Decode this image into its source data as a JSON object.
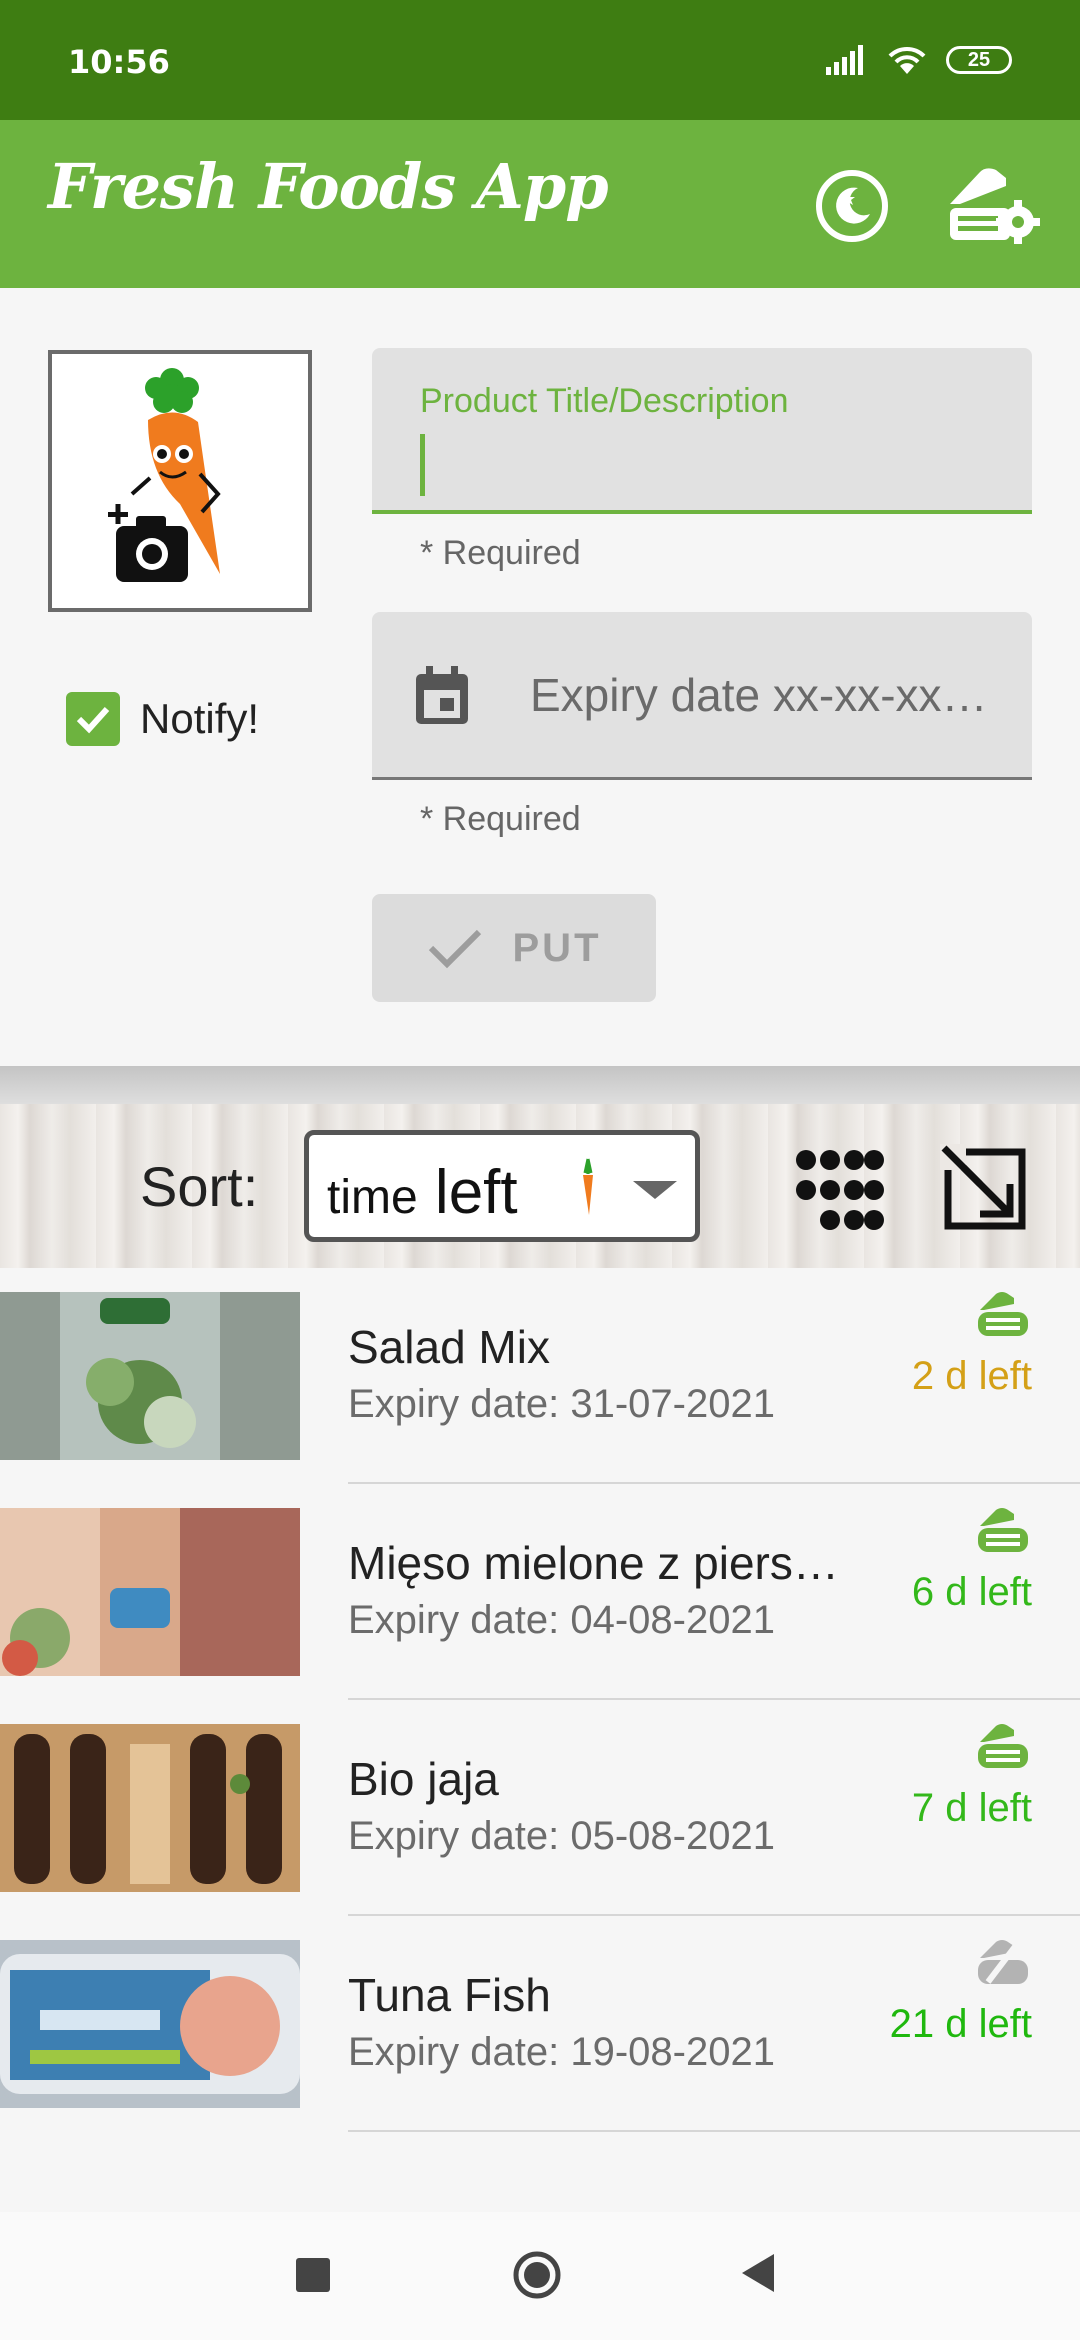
{
  "status_bar": {
    "time": "10:56",
    "battery": "25"
  },
  "app_bar": {
    "title": "Fresh Foods App"
  },
  "form": {
    "title_field": {
      "label": "Product Title/Description",
      "value": "",
      "helper": "* Required"
    },
    "date_field": {
      "placeholder": "Expiry date xx-xx-xx…",
      "helper": "* Required"
    },
    "notify": {
      "label": "Notify!",
      "checked": true
    },
    "put_button": {
      "label": "PUT"
    }
  },
  "sort": {
    "label": "Sort:",
    "selected_small": "time",
    "selected_big": "left"
  },
  "items": [
    {
      "title": "Salad Mix",
      "expiry": "Expiry date: 31-07-2021",
      "days": "2 d left",
      "days_color": "#d4a017",
      "notify": true
    },
    {
      "title": "Mięso mielone z piers…",
      "expiry": "Expiry date: 04-08-2021",
      "days": "6 d left",
      "days_color": "#33b81a",
      "notify": true
    },
    {
      "title": "Bio jaja",
      "expiry": "Expiry date: 05-08-2021",
      "days": "7 d left",
      "days_color": "#33b81a",
      "notify": true
    },
    {
      "title": "Tuna Fish",
      "expiry": "Expiry date: 19-08-2021",
      "days": "21 d left",
      "days_color": "#1fb80e",
      "notify": false
    }
  ],
  "colors": {
    "primary": "#6db33f",
    "status_bar": "#3e7d12"
  },
  "icons": {
    "app_bar": [
      "moon-star-icon",
      "notification-settings-icon"
    ],
    "form": [
      "add-photo-icon",
      "calendar-icon",
      "check-icon"
    ],
    "sort": [
      "carrot-icon",
      "grid-view-icon",
      "expand-icon"
    ],
    "item_notify_on": "notification-on-icon",
    "item_notify_off": "notification-off-icon"
  }
}
